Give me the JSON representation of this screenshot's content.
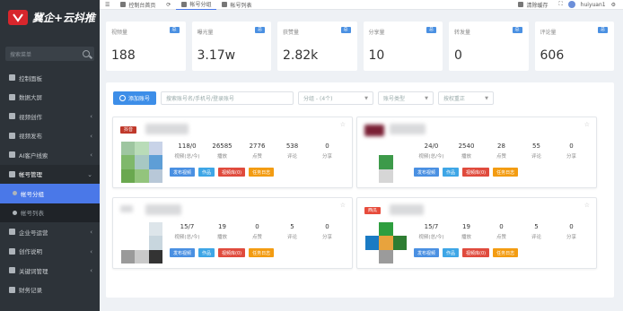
{
  "app": {
    "logo_text": "冀企+云抖推"
  },
  "sidebar": {
    "search_placeholder": "搜索菜单",
    "items": [
      {
        "label": "控制面板"
      },
      {
        "label": "数据大屏"
      },
      {
        "label": "视频创作"
      },
      {
        "label": "视频发布"
      },
      {
        "label": "AI客户线索"
      },
      {
        "label": "帐号管理"
      },
      {
        "label": "帐号分组"
      },
      {
        "label": "帐号列表"
      },
      {
        "label": "企业号运营"
      },
      {
        "label": "创作说明"
      },
      {
        "label": "关键词管理"
      },
      {
        "label": "财务记录"
      }
    ]
  },
  "topbar": {
    "tabs": [
      {
        "label": "控制台首页"
      },
      {
        "label": "帐号分组"
      },
      {
        "label": "帐号列表"
      }
    ],
    "clear_cache": "清除缓存",
    "username": "huiyuan1"
  },
  "stats": [
    {
      "label": "视频量",
      "tag": "总",
      "value": "188"
    },
    {
      "label": "曝光量",
      "tag": "总",
      "value": "3.17w"
    },
    {
      "label": "获赞量",
      "tag": "总",
      "value": "2.82k"
    },
    {
      "label": "分享量",
      "tag": "总",
      "value": "10"
    },
    {
      "label": "转发量",
      "tag": "总",
      "value": "0"
    },
    {
      "label": "评论量",
      "tag": "总",
      "value": "606"
    }
  ],
  "filters": {
    "add_button": "添加账号",
    "search_placeholder": "搜索账号名/手机号/登录账号",
    "group_select": "分组 - (4个)",
    "type_select": "账号类型",
    "sort_select": "按权重正"
  },
  "colors": {
    "accent": "#4a78e8",
    "sidebar_bg": "#2d3339"
  },
  "metric_labels": [
    "视频(总/今)",
    "播放",
    "点赞",
    "评论",
    "分享"
  ],
  "action_labels": [
    "发布视频",
    "作品",
    "视频库(0)",
    "任务日志"
  ],
  "cards": [
    {
      "badge": "抖音",
      "badge_color": "#c0392b",
      "metrics": [
        "118/0",
        "26585",
        "2776",
        "538",
        "0"
      ]
    },
    {
      "badge": "",
      "badge_color": "",
      "metrics": [
        "24/0",
        "2540",
        "28",
        "55",
        "0"
      ]
    },
    {
      "badge": "",
      "badge_color": "",
      "metrics": [
        "15/7",
        "19",
        "0",
        "5",
        "0"
      ]
    },
    {
      "badge": "西瓜",
      "badge_color": "#e74c3c",
      "metrics": [
        "15/7",
        "19",
        "0",
        "5",
        "0"
      ]
    }
  ]
}
